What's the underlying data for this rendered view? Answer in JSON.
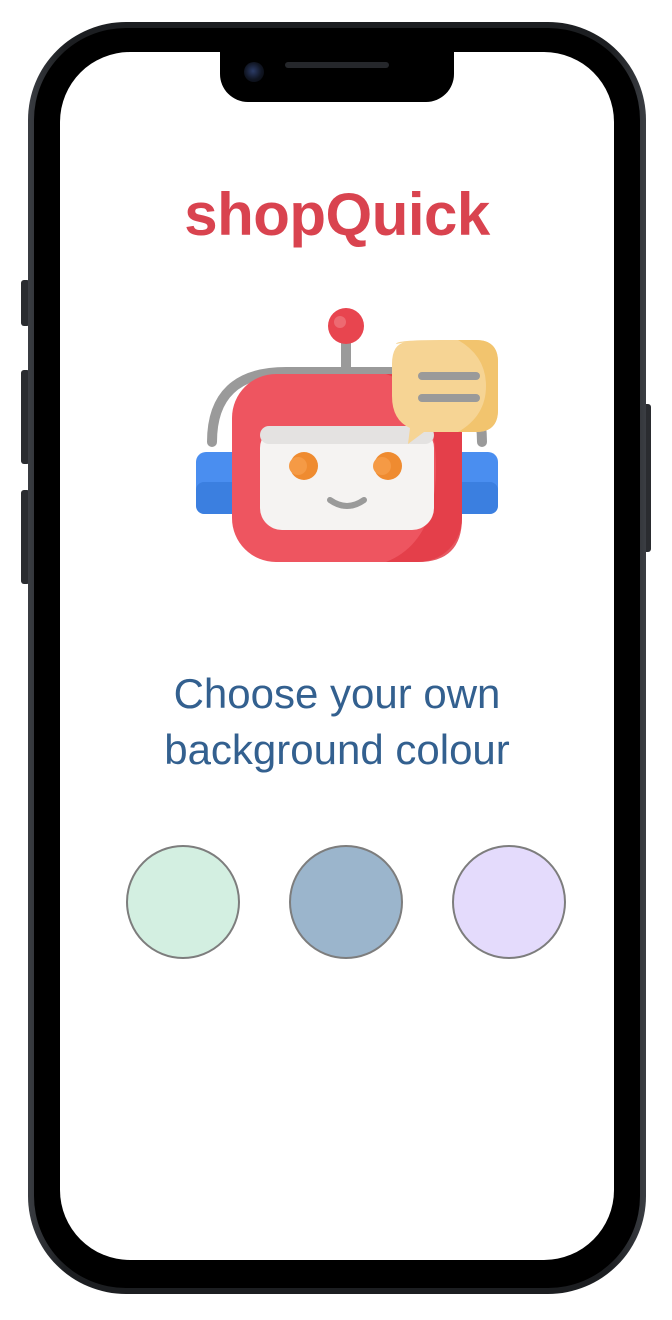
{
  "app": {
    "title": "shopQuick"
  },
  "mascot": {
    "icon": "robot-chat-icon"
  },
  "prompt": {
    "line1": "Choose your own",
    "line2": "background colour"
  },
  "swatches": [
    {
      "name": "mint",
      "color": "#d3efe1"
    },
    {
      "name": "slate-blue",
      "color": "#9bb5cc"
    },
    {
      "name": "lavender",
      "color": "#e4dbfc"
    }
  ],
  "colors": {
    "brand": "#d9434f",
    "prompt_text": "#33608f"
  }
}
